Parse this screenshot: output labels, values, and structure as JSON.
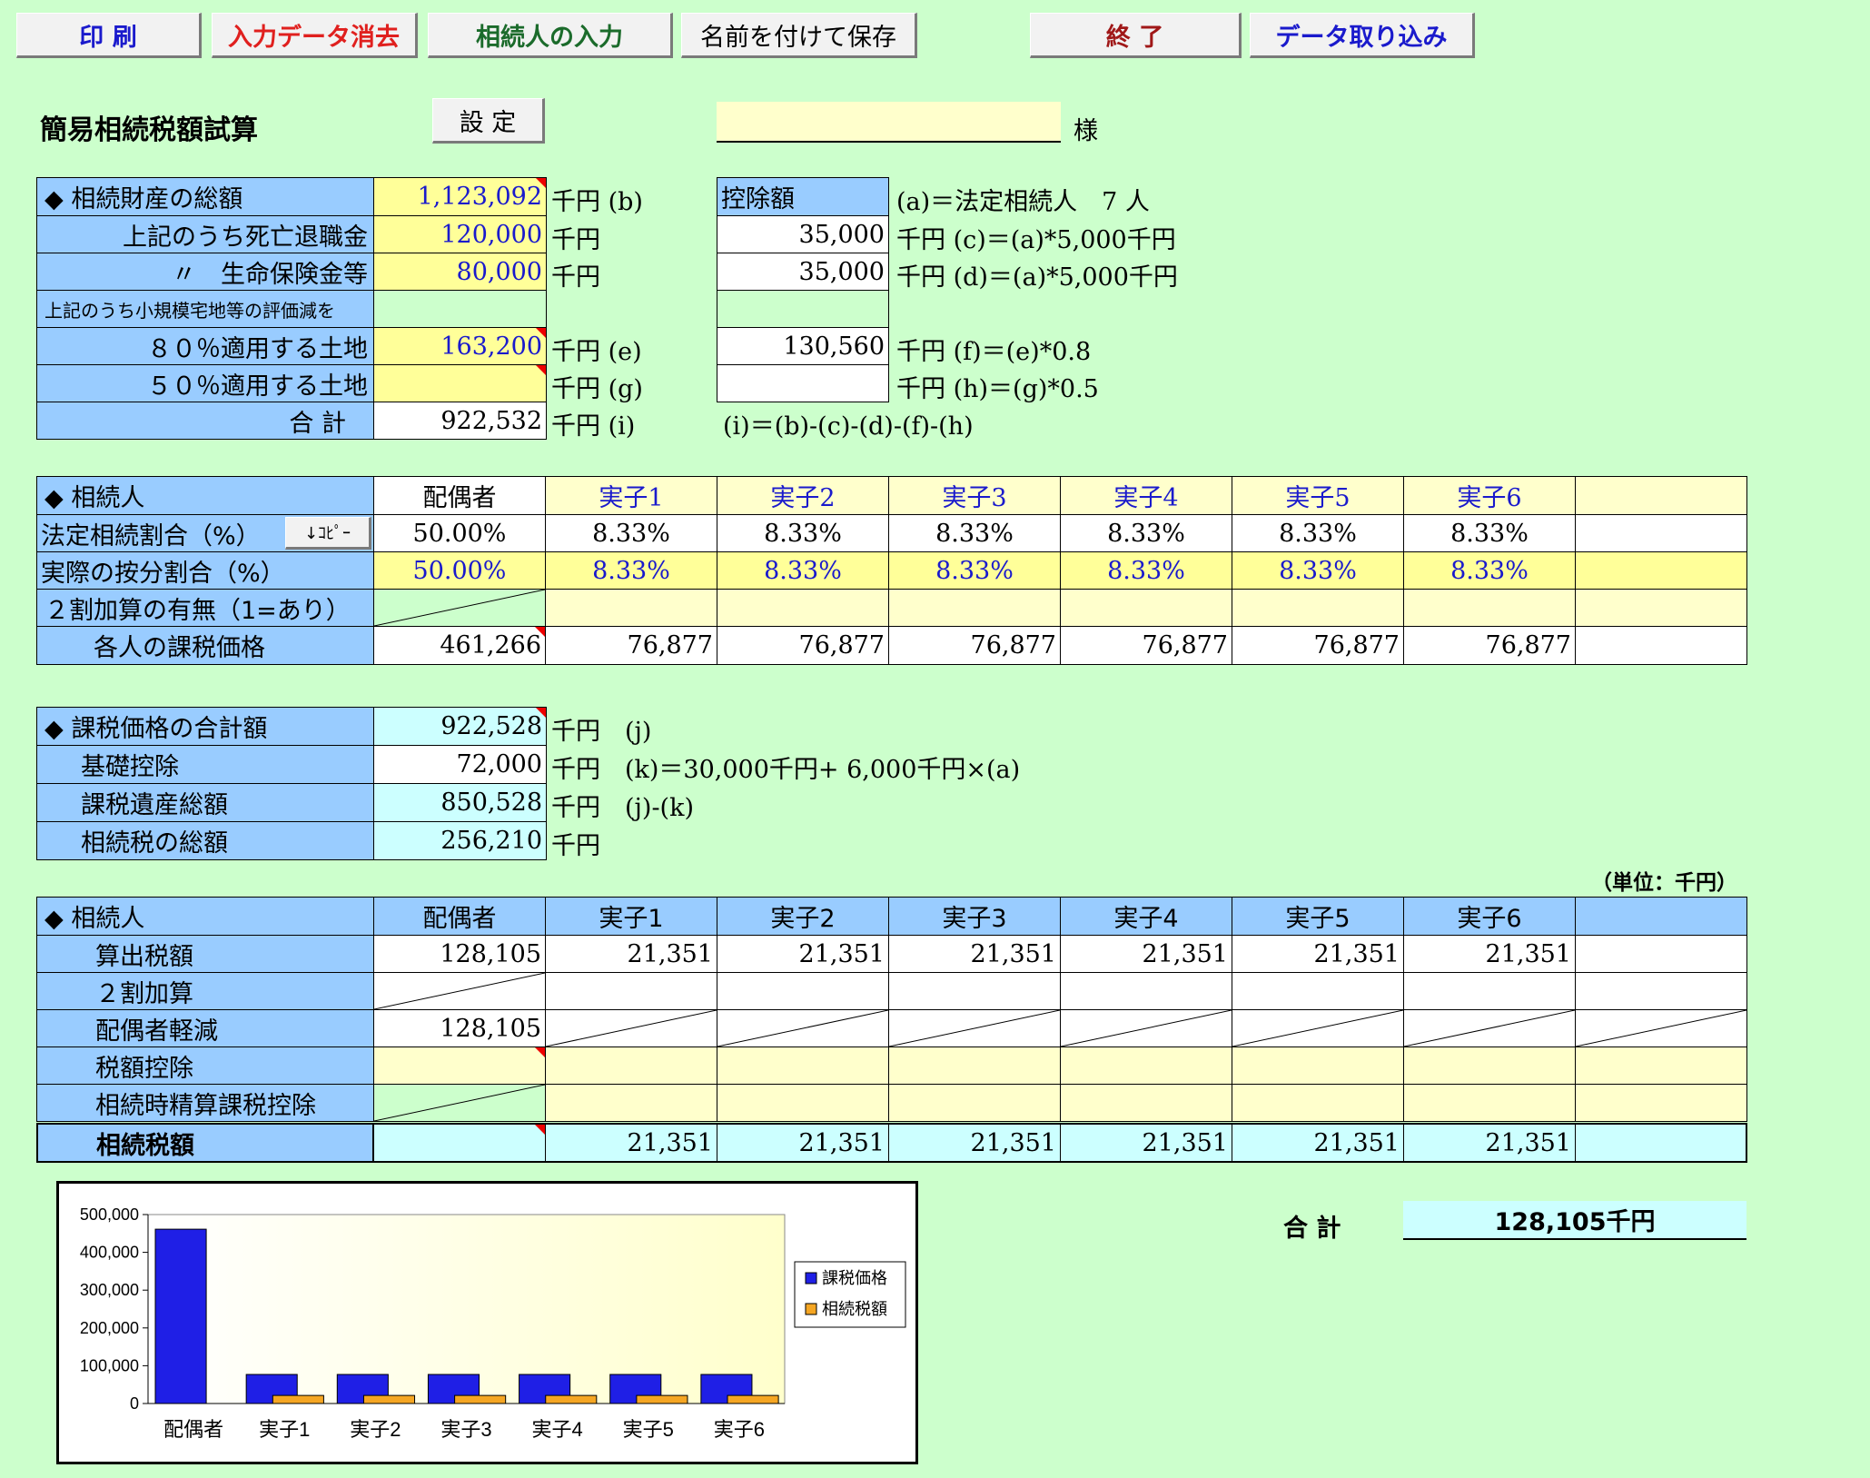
{
  "toolbar": {
    "print": "印 刷",
    "clear": "入力データ消去",
    "heirs_input": "相続人の入力",
    "save_as": "名前を付けて保存",
    "exit": "終 了",
    "import": "データ取り込み"
  },
  "colors": {
    "print": "#1a1acc",
    "clear": "#e0201e",
    "heirs_input": "#1b6b2b",
    "save_as": "#000000",
    "exit": "#a01818",
    "import": "#1a1acc"
  },
  "header": {
    "title": "簡易相続税額試算",
    "settings": "設 定",
    "name_value": "",
    "honorific": "様"
  },
  "estate": {
    "rows": [
      {
        "label": "◆ 相続財産の総額",
        "value": "1,123,092",
        "unit": "千円 (b)"
      },
      {
        "label": "上記のうち死亡退職金",
        "value": "120,000",
        "unit": "千円"
      },
      {
        "label": "〃　生命保険金等",
        "value": "80,000",
        "unit": "千円"
      },
      {
        "label": "上記のうち小規模宅地等の評価減を",
        "value": "",
        "unit": ""
      },
      {
        "label": "８０％適用する土地",
        "value": "163,200",
        "unit": "千円 (e)"
      },
      {
        "label": "５０％適用する土地",
        "value": "",
        "unit": "千円 (g)"
      }
    ],
    "total_label": "合 計",
    "total_value": "922,532",
    "total_unit": "千円 (i)",
    "deduction_header": "控除額",
    "legal_heirs_note": "(a)＝法定相続人　7 人",
    "deductions": [
      {
        "value": "35,000",
        "note": "千円 (c)＝(a)*5,000千円"
      },
      {
        "value": "35,000",
        "note": "千円 (d)＝(a)*5,000千円"
      },
      {
        "value": "",
        "note": ""
      },
      {
        "value": "130,560",
        "note": "千円 (f)＝(e)*0.8"
      },
      {
        "value": "",
        "note": "千円 (h)＝(g)*0.5"
      }
    ],
    "formula": "(i)＝(b)-(c)-(d)-(f)-(h)"
  },
  "heirs": {
    "header_label": "◆ 相続人",
    "names": [
      "配偶者",
      "実子1",
      "実子2",
      "実子3",
      "実子4",
      "実子5",
      "実子6",
      ""
    ],
    "legal_ratio_label": "法定相続割合（%）",
    "copy_button": "↓ｺﾋﾟｰ",
    "legal_ratio": [
      "50.00%",
      "8.33%",
      "8.33%",
      "8.33%",
      "8.33%",
      "8.33%",
      "8.33%",
      ""
    ],
    "actual_ratio_label": "実際の按分割合（%）",
    "actual_ratio": [
      "50.00%",
      "8.33%",
      "8.33%",
      "8.33%",
      "8.33%",
      "8.33%",
      "8.33%",
      ""
    ],
    "surcharge_label": "２割加算の有無（1=あり）",
    "taxable_label": "各人の課税価格",
    "taxable": [
      "461,266",
      "76,877",
      "76,877",
      "76,877",
      "76,877",
      "76,877",
      "76,877",
      ""
    ]
  },
  "summary": {
    "rows": [
      {
        "label": "◆ 課税価格の合計額",
        "value": "922,528",
        "unit": "千円　(j)"
      },
      {
        "label": "基礎控除",
        "value": "72,000",
        "unit": "千円　(k)＝30,000千円+ 6,000千円×(a)"
      },
      {
        "label": "課税遺産総額",
        "value": "850,528",
        "unit": "千円　(j)-(k)"
      },
      {
        "label": "相続税の総額",
        "value": "256,210",
        "unit": "千円"
      }
    ],
    "unit_note": "（単位：千円）"
  },
  "tax": {
    "header_label": "◆ 相続人",
    "names": [
      "配偶者",
      "実子1",
      "実子2",
      "実子3",
      "実子4",
      "実子5",
      "実子6",
      ""
    ],
    "calc_label": "算出税額",
    "calc": [
      "128,105",
      "21,351",
      "21,351",
      "21,351",
      "21,351",
      "21,351",
      "21,351",
      ""
    ],
    "surcharge_label": "２割加算",
    "spouse_label": "配偶者軽減",
    "spouse_value": "128,105",
    "credit_label": "税額控除",
    "settlement_label": "相続時精算課税控除",
    "final_label": "相続税額",
    "final": [
      "",
      "21,351",
      "21,351",
      "21,351",
      "21,351",
      "21,351",
      "21,351",
      ""
    ]
  },
  "total": {
    "label": "合 計",
    "value": "128,105千円"
  },
  "chart_data": {
    "type": "bar",
    "categories": [
      "配偶者",
      "実子1",
      "実子2",
      "実子3",
      "実子4",
      "実子5",
      "実子6"
    ],
    "series": [
      {
        "name": "課税価格",
        "values": [
          461266,
          76877,
          76877,
          76877,
          76877,
          76877,
          76877
        ],
        "color": "#1f1fe6"
      },
      {
        "name": "相続税額",
        "values": [
          0,
          21351,
          21351,
          21351,
          21351,
          21351,
          21351
        ],
        "color": "#f5a623"
      }
    ],
    "yticks": [
      "0",
      "100,000",
      "200,000",
      "300,000",
      "400,000",
      "500,000"
    ],
    "ylim": [
      0,
      500000
    ]
  }
}
